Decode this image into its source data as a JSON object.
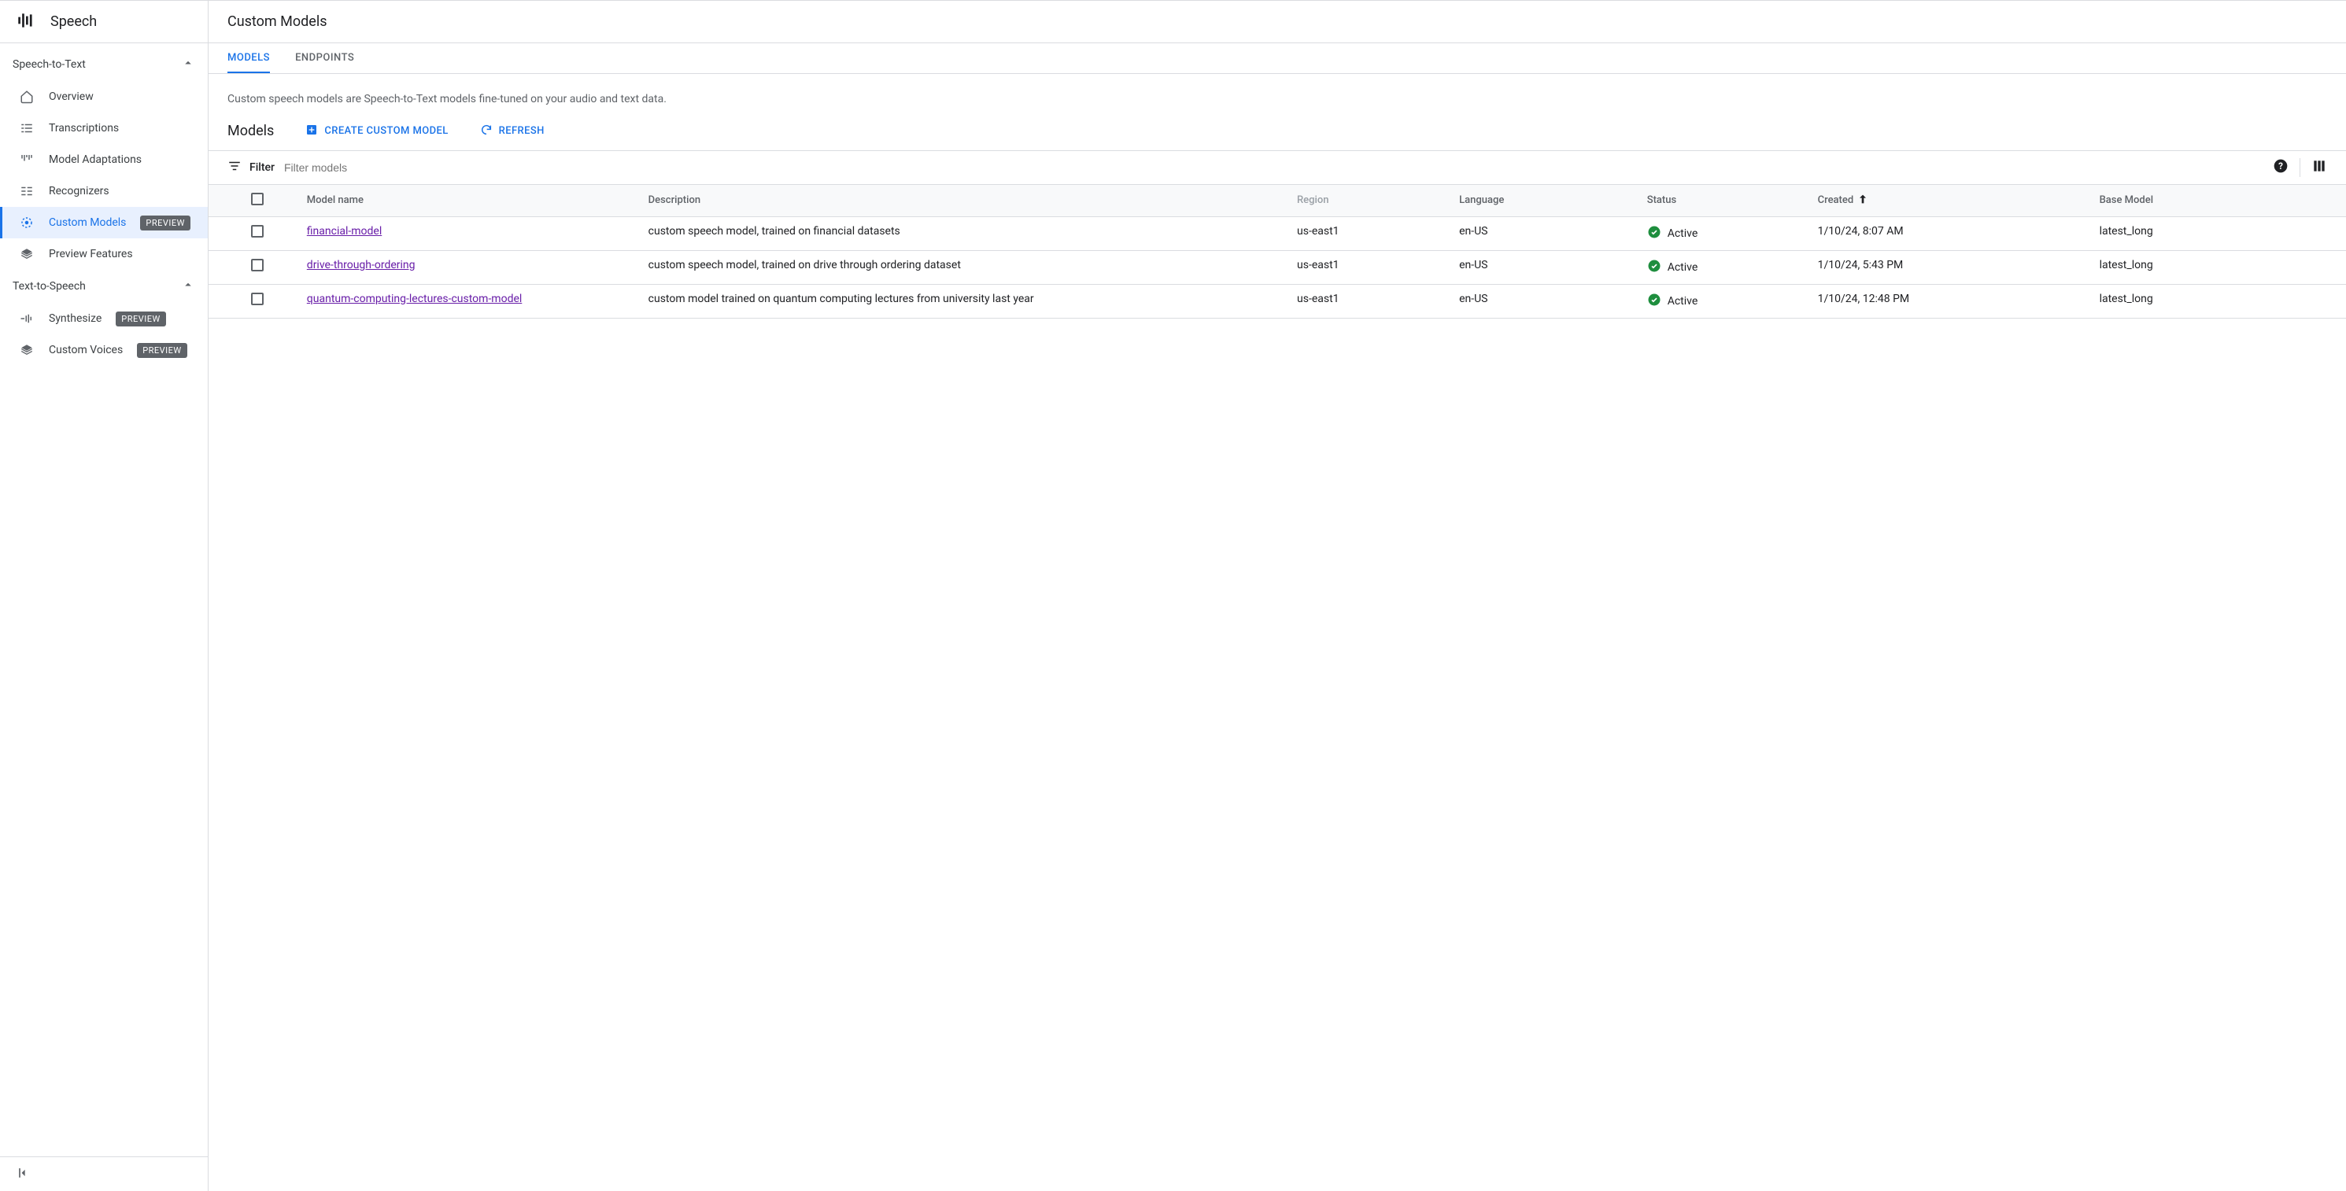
{
  "product_name": "Speech",
  "sidebar": {
    "sections": [
      {
        "title": "Speech-to-Text",
        "items": [
          {
            "label": "Overview",
            "icon": "home-icon"
          },
          {
            "label": "Transcriptions",
            "icon": "transcriptions-icon"
          },
          {
            "label": "Model Adaptations",
            "icon": "adaptations-icon"
          },
          {
            "label": "Recognizers",
            "icon": "recognizers-icon"
          },
          {
            "label": "Custom Models",
            "icon": "custom-models-icon",
            "badge": "PREVIEW",
            "selected": true
          },
          {
            "label": "Preview Features",
            "icon": "preview-features-icon"
          }
        ]
      },
      {
        "title": "Text-to-Speech",
        "items": [
          {
            "label": "Synthesize",
            "icon": "synthesize-icon",
            "badge": "PREVIEW"
          },
          {
            "label": "Custom Voices",
            "icon": "custom-voices-icon",
            "badge": "PREVIEW"
          }
        ]
      }
    ]
  },
  "page_title": "Custom Models",
  "tabs": [
    {
      "label": "MODELS",
      "active": true
    },
    {
      "label": "ENDPOINTS",
      "active": false
    }
  ],
  "intro_text": "Custom speech models are Speech-to-Text models fine-tuned on your audio and text data.",
  "section": {
    "title": "Models",
    "create_label": "CREATE CUSTOM MODEL",
    "refresh_label": "REFRESH"
  },
  "filter": {
    "label": "Filter",
    "placeholder": "Filter models"
  },
  "table": {
    "headers": {
      "name": "Model name",
      "desc": "Description",
      "region": "Region",
      "language": "Language",
      "status": "Status",
      "created": "Created",
      "base": "Base Model"
    },
    "sort_column": "created",
    "sort_dir": "asc",
    "rows": [
      {
        "name": "financial-model",
        "desc": "custom speech model, trained on financial datasets",
        "region": "us-east1",
        "language": "en-US",
        "status": "Active",
        "created": "1/10/24, 8:07 AM",
        "base": "latest_long"
      },
      {
        "name": "drive-through-ordering",
        "desc": "custom speech model, trained on drive through ordering dataset",
        "region": "us-east1",
        "language": "en-US",
        "status": "Active",
        "created": "1/10/24, 5:43 PM",
        "base": "latest_long"
      },
      {
        "name": "quantum-computing-lectures-custom-model",
        "desc": "custom model trained on quantum computing lectures from university last year",
        "region": "us-east1",
        "language": "en-US",
        "status": "Active",
        "created": "1/10/24, 12:48 PM",
        "base": "latest_long"
      }
    ]
  },
  "colors": {
    "accent": "#1a73e8",
    "link": "#681da8",
    "success": "#1e8e3e"
  }
}
